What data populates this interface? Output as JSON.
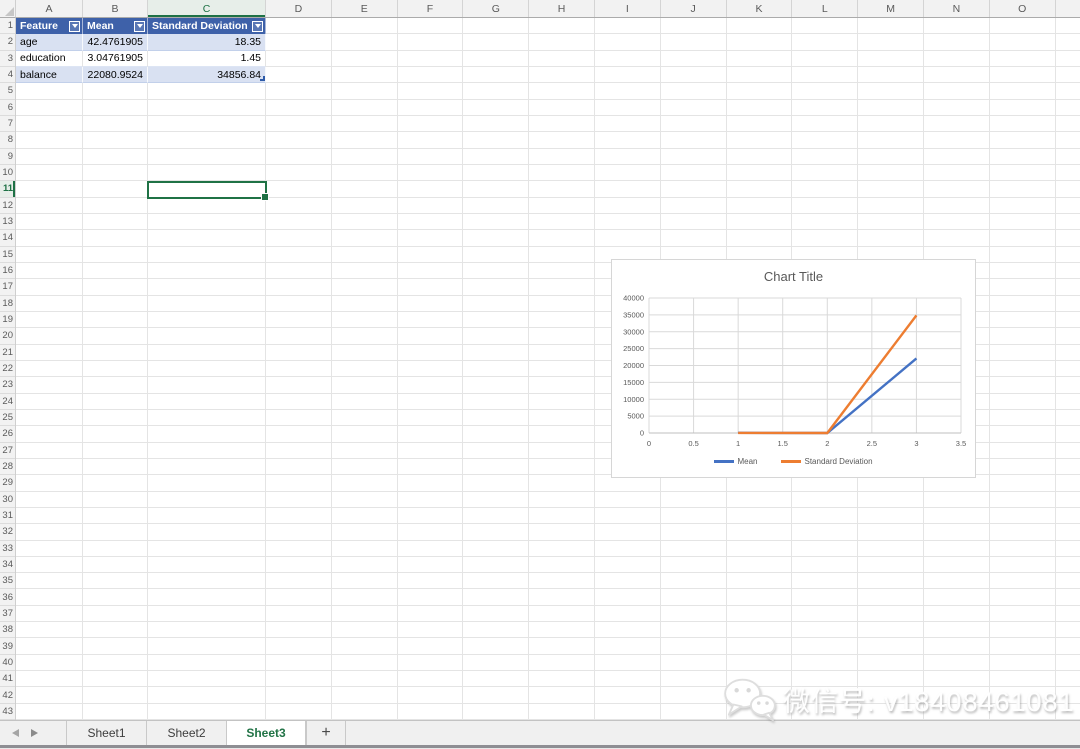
{
  "spreadsheet": {
    "column_letters": [
      "A",
      "B",
      "C",
      "D",
      "E",
      "F",
      "G",
      "H",
      "I",
      "J",
      "K",
      "L",
      "M",
      "N",
      "O"
    ],
    "row_numbers": [
      "1",
      "2",
      "3",
      "4",
      "5",
      "6",
      "7",
      "8",
      "9",
      "10",
      "11",
      "12",
      "13",
      "14",
      "15",
      "16",
      "17",
      "18",
      "19",
      "20",
      "21",
      "22",
      "23",
      "24",
      "25",
      "26",
      "27",
      "28",
      "29",
      "30",
      "31",
      "32",
      "33",
      "34",
      "35",
      "36",
      "37",
      "38",
      "39",
      "40",
      "41",
      "42",
      "43"
    ],
    "selected_column": "C",
    "selected_row": "11",
    "selected_cell": "C11",
    "selection_color": "#1F7245"
  },
  "table": {
    "headers": [
      "Feature",
      "Mean",
      "Standard Deviation"
    ],
    "rows": [
      {
        "feature": "age",
        "mean": "42.4761905",
        "std": "18.35"
      },
      {
        "feature": "education",
        "mean": "3.04761905",
        "std": "1.45"
      },
      {
        "feature": "balance",
        "mean": "22080.9524",
        "std": "34856.84"
      }
    ],
    "header_bg": "#3E61A9",
    "band_bg": "#D9E1F2"
  },
  "chart_data": {
    "type": "line",
    "title": "Chart Title",
    "x": [
      1,
      2,
      3
    ],
    "series": [
      {
        "name": "Mean",
        "color": "#4472C4",
        "values": [
          42.4761905,
          3.04761905,
          22080.9524
        ]
      },
      {
        "name": "Standard Deviation",
        "color": "#ED7D31",
        "values": [
          18.35,
          1.45,
          34856.84
        ]
      }
    ],
    "xlim": [
      0,
      3.5
    ],
    "ylim": [
      0,
      40000
    ],
    "x_ticks": [
      0,
      0.5,
      1,
      1.5,
      2,
      2.5,
      3,
      3.5
    ],
    "y_ticks": [
      0,
      5000,
      10000,
      15000,
      20000,
      25000,
      30000,
      35000,
      40000
    ],
    "grid": true,
    "legend_position": "bottom",
    "axis_color": "#BFBFBF",
    "grid_color": "#D9D9D9",
    "tick_label_color": "#595959"
  },
  "sheet_tabs": {
    "items": [
      {
        "label": "Sheet1",
        "active": false
      },
      {
        "label": "Sheet2",
        "active": false
      },
      {
        "label": "Sheet3",
        "active": true
      }
    ],
    "add_button": "+",
    "active_color": "#217346"
  },
  "watermark": {
    "icon": "wechat-icon",
    "text": "微信号: v18408461081"
  }
}
